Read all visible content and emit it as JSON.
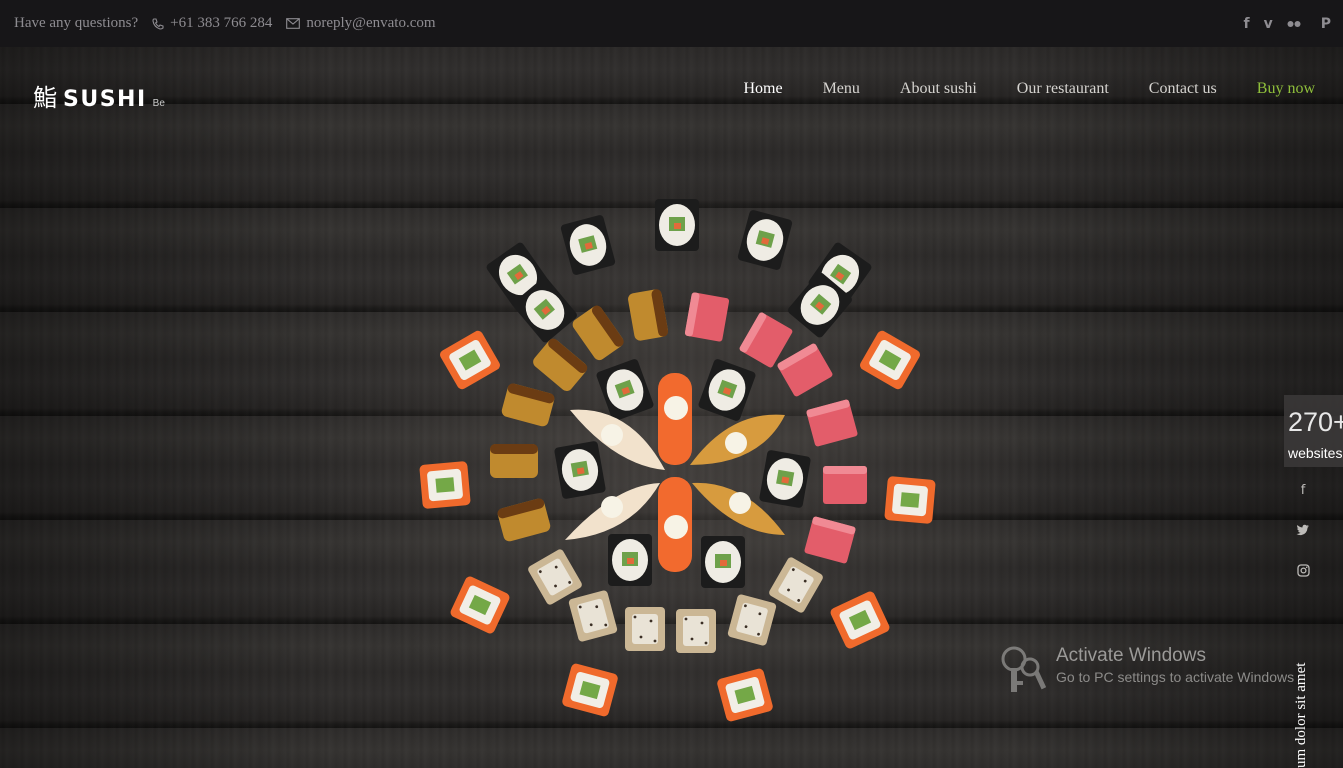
{
  "topbar": {
    "question": "Have any questions?",
    "phone": "+61 383 766 284",
    "email": "noreply@envato.com",
    "socials": [
      "facebook-icon",
      "vimeo-icon",
      "flickr-icon",
      "pinterest-icon"
    ]
  },
  "logo": {
    "kanji": "鮨",
    "word": "SUSHI",
    "sub": "Be"
  },
  "nav": {
    "items": [
      {
        "label": "Home",
        "active": true
      },
      {
        "label": "Menu"
      },
      {
        "label": "About sushi"
      },
      {
        "label": "Our restaurant"
      },
      {
        "label": "Contact us"
      },
      {
        "label": "Buy now",
        "accent": "#8fbf3b"
      }
    ]
  },
  "side_widget": {
    "count": "270+",
    "label": "websites"
  },
  "side_socials": [
    "facebook-icon",
    "twitter-icon",
    "instagram-icon"
  ],
  "vertical_text": "um dolor sit amet",
  "activation": {
    "title": "Activate Windows",
    "subtitle": "Go to PC settings to activate Windows"
  },
  "colors": {
    "accent": "#8fbf3b",
    "topbar_bg": "#171618"
  }
}
